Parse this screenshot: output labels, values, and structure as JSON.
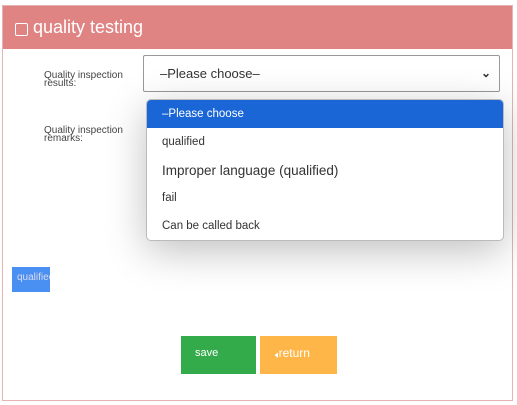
{
  "header": {
    "title": "quality testing",
    "icon": "edit-icon"
  },
  "form": {
    "results_label": "Quality inspection results:",
    "remarks_label": "Quality inspection remarks:",
    "select_value": "–Please choose–",
    "options": [
      "–Please choose",
      "qualified",
      "Improper language (qualified)",
      "fail",
      "Can be called back"
    ],
    "tag": "qualified"
  },
  "buttons": {
    "save": "save",
    "return": "return",
    "return_icon": "arrow-left-icon"
  },
  "colors": {
    "header": "#e08383",
    "selected": "#1a66d6",
    "save": "#34ab4a",
    "return": "#ffb648"
  }
}
